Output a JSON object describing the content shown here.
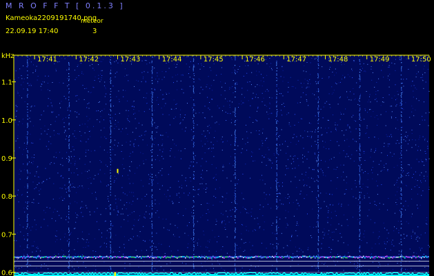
{
  "header": {
    "app_title": "M R O F F T  [ 0.1.3 ]",
    "file_name": "Kameoka2209191740.png",
    "datetime": "22.09.19 17:40",
    "meteor_label": "meteor",
    "meteor_count": "3"
  },
  "colors": {
    "background": "#000000",
    "plot_background": "#000a5a",
    "title": "#8080ff",
    "text": "#ffff00",
    "axis": "#ffff00",
    "signal_cyan": "#00ffff",
    "noise_dots": "#2a50ff",
    "white_lines": "#ffffff"
  },
  "chart_data": {
    "type": "heatmap",
    "title": "",
    "xlabel": "",
    "ylabel": "kHz",
    "x_ticks": [
      "17:41",
      "17:42",
      "17:43",
      "17:44",
      "17:45",
      "17:46",
      "17:47",
      "17:48",
      "17:49",
      "17:50"
    ],
    "x_range": [
      "17:40:30",
      "17:50:30"
    ],
    "y_ticks": [
      0.6,
      0.7,
      0.8,
      0.9,
      1.0,
      1.1
    ],
    "ylim": [
      0.59,
      1.17
    ],
    "grid": false,
    "vertical_interference_minutes": [
      0.82,
      1.82,
      2.82,
      3.82,
      4.82,
      5.82,
      6.82,
      7.82,
      8.82,
      9.82
    ],
    "carrier_band_khz": 0.64,
    "meteor_echoes": [
      {
        "time": "17:43:00",
        "khz": 0.866
      },
      {
        "time": "17:42:56",
        "khz": 0.6
      }
    ]
  }
}
